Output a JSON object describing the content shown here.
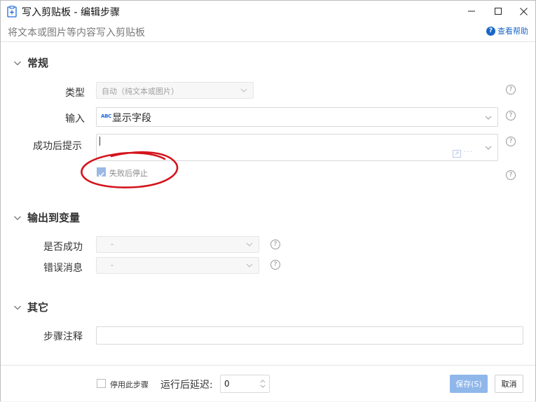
{
  "window": {
    "title": "写入剪贴板  -  编辑步骤",
    "subtitle": "将文本或图片等内容写入剪贴板",
    "help_label": "查看帮助"
  },
  "sections": {
    "general": "常规",
    "output": "输出到变量",
    "other": "其它"
  },
  "general": {
    "type_label": "类型",
    "type_value": "自动（纯文本或图片）",
    "input_label": "输入",
    "input_value": "显示字段",
    "input_badge": "ABC",
    "success_label": "成功后提示",
    "success_value": "",
    "stop_on_fail_label": "失败后停止",
    "stop_on_fail_checked": true
  },
  "output": {
    "success_var_label": "是否成功",
    "success_var_value": "-",
    "error_var_label": "错误消息",
    "error_var_value": "-"
  },
  "other": {
    "note_label": "步骤注释",
    "note_value": ""
  },
  "footer": {
    "disable_label": "停用此步骤",
    "delay_label": "运行后延迟:",
    "delay_value": "0",
    "save_label": "保存(S)",
    "cancel_label": "取消"
  },
  "colors": {
    "accent": "#1a67c7",
    "save_button": "#8fb7ea",
    "annotation": "#d4141c"
  }
}
